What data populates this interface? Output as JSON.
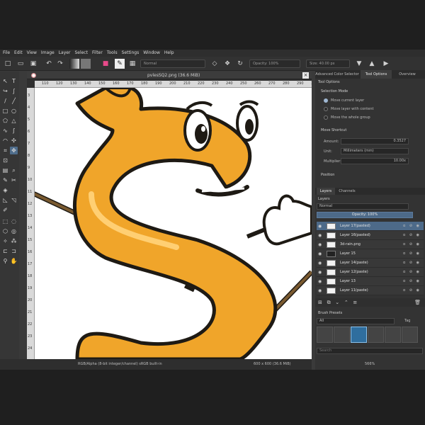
{
  "menu": [
    "File",
    "Edit",
    "View",
    "Image",
    "Layer",
    "Select",
    "Filter",
    "Tools",
    "Settings",
    "Window",
    "Help"
  ],
  "toolbar": {
    "blend_mode": "Normal",
    "opacity": "Opacity: 100%",
    "size": "Size: 40.00 px"
  },
  "document": {
    "title": "pvlesSQ2.png (36.6 MiB)",
    "ruler_h": [
      "110",
      "120",
      "130",
      "140",
      "150",
      "160",
      "170",
      "180",
      "190",
      "200",
      "210",
      "220",
      "230",
      "240",
      "250",
      "260",
      "270",
      "280",
      "290",
      "300"
    ],
    "ruler_v": [
      "3",
      "4",
      "5",
      "6",
      "7",
      "8",
      "9",
      "10",
      "11",
      "12",
      "13",
      "14",
      "15",
      "16",
      "17",
      "18",
      "19",
      "20",
      "21",
      "22",
      "23",
      "24"
    ]
  },
  "dock": {
    "tabs": [
      "Advanced Color Selector",
      "Tool Options",
      "Overview"
    ],
    "tool_options_title": "Tool Options",
    "selection_mode_label": "Selection Mode",
    "modes": [
      "Move current layer",
      "Move layer with content",
      "Move the whole group"
    ],
    "move_shortcut_label": "Move Shortcut",
    "amount_label": "Amount:",
    "amount_value": "0.3527",
    "unit_label": "Unit:",
    "unit_value": "Millimeters (mm)",
    "multiplier_label": "Multiplier:",
    "multiplier_value": "10.00x",
    "position_label": "Position"
  },
  "layers": {
    "tabs": [
      "Layers",
      "Channels"
    ],
    "title": "Layers",
    "mode": "Normal",
    "opacity": "Opacity:  100%",
    "items": [
      "Layer 17(pasted)",
      "Layer 16(pasted)",
      "3d-rain.png",
      "Layer 15",
      "Layer 14(paste)",
      "Layer 12(paste)",
      "Layer 13",
      "Layer 11(paste)"
    ]
  },
  "brush_presets": {
    "title": "Brush Presets",
    "filter": "All",
    "tag": "Tag",
    "search_placeholder": "Search"
  },
  "status": {
    "color_info": "RGB/Alpha (8-bit integer/channel)  sRGB built-in",
    "size_info": "600 x 600 (36.6 MiB)",
    "zoom": "566%"
  },
  "colors": {
    "accent": "#4d6a89",
    "dollar_orange": "#f0a52a",
    "outline": "#1e1a14"
  }
}
